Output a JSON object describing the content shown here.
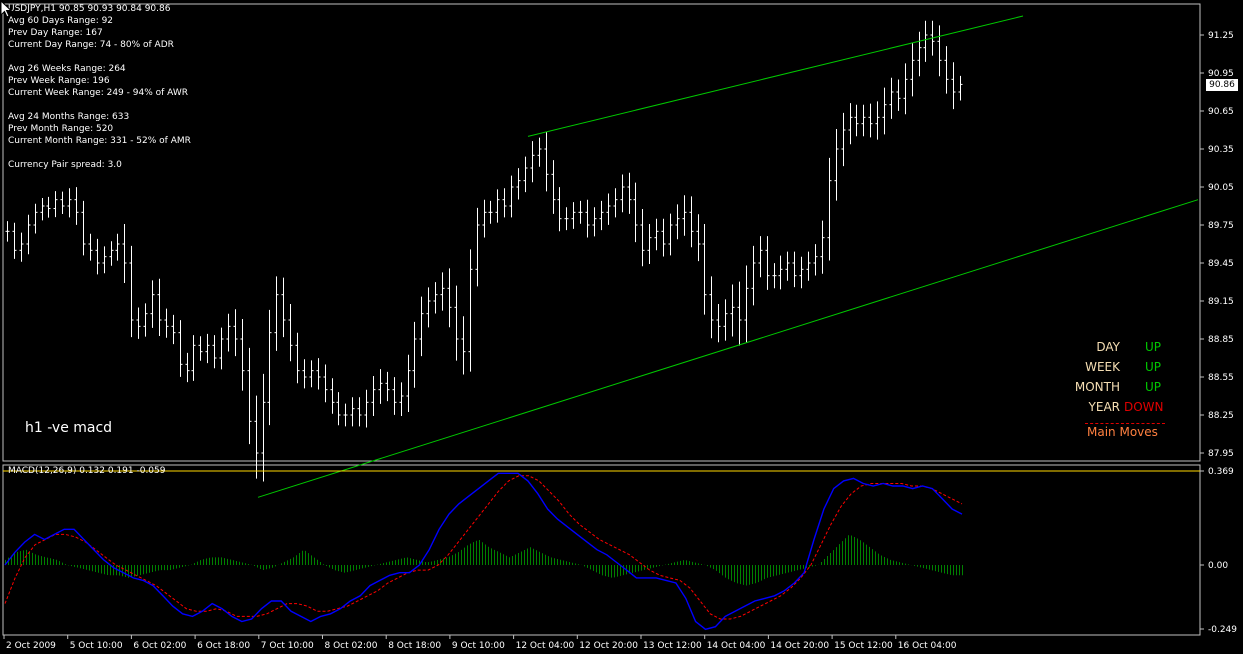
{
  "symbol_header": "USDJPY,H1  90.85 90.93 90.84 90.86",
  "info_lines": [
    "Avg 60 Days Range: 92",
    "Prev Day Range: 167",
    "Current Day Range: 74 - 80% of ADR",
    "",
    "Avg 26 Weeks Range: 264",
    "Prev Week Range: 196",
    "Current Week Range: 249 - 94% of AWR",
    "",
    "Avg 24 Months Range: 633",
    "Prev Month Range: 520",
    "Current Month Range: 331 - 52% of AMR",
    "",
    "Currency Pair spread: 3.0"
  ],
  "chart_note": "h1 -ve macd",
  "current_price": "90.86",
  "trend_panel": {
    "rows": [
      {
        "label": "DAY",
        "value": "UP",
        "state": "up"
      },
      {
        "label": "WEEK",
        "value": "UP",
        "state": "up"
      },
      {
        "label": "MONTH",
        "value": "UP",
        "state": "up"
      },
      {
        "label": "YEAR",
        "value": "DOWN",
        "state": "down"
      }
    ],
    "footer": "Main Moves"
  },
  "macd_title": "MACD(12,26,9) 0.132 0.191 -0.059",
  "colors": {
    "background": "#000000",
    "candles": "#ffffff",
    "channel": "#00c800",
    "macd_line": "#0000ff",
    "signal_line": "#ff0000",
    "histogram": "#008000",
    "level_line": "#ffd700",
    "trend_label": "#f5deb3",
    "trend_up": "#00c800",
    "trend_down": "#e00000",
    "moves": "#ff8040"
  },
  "chart_data": [
    {
      "type": "ohlc",
      "price_axis": {
        "ylim": [
          87.6,
          91.4
        ],
        "ticks": [
          "91.25",
          "90.95",
          "90.65",
          "90.35",
          "90.05",
          "89.75",
          "89.45",
          "89.15",
          "88.85",
          "88.55",
          "88.25",
          "87.95"
        ]
      },
      "time_axis": {
        "ticks": [
          "2 Oct 2009",
          "5 Oct 10:00",
          "6 Oct 02:00",
          "6 Oct 18:00",
          "7 Oct 10:00",
          "8 Oct 02:00",
          "8 Oct 18:00",
          "9 Oct 10:00",
          "12 Oct 04:00",
          "12 Oct 20:00",
          "13 Oct 12:00",
          "14 Oct 04:00",
          "14 Oct 20:00",
          "15 Oct 12:00",
          "16 Oct 04:00"
        ]
      },
      "close_path": [
        89.7,
        89.55,
        89.6,
        89.75,
        89.85,
        89.9,
        89.88,
        89.95,
        89.9,
        89.95,
        89.85,
        89.6,
        89.55,
        89.45,
        89.5,
        89.55,
        89.6,
        89.45,
        89.0,
        88.95,
        89.05,
        89.2,
        89.0,
        88.95,
        88.9,
        88.65,
        88.6,
        88.8,
        88.75,
        88.8,
        88.7,
        88.85,
        88.95,
        88.85,
        88.6,
        88.2,
        87.95,
        88.35,
        88.9,
        89.2,
        89.0,
        88.8,
        88.6,
        88.55,
        88.6,
        88.55,
        88.45,
        88.35,
        88.25,
        88.25,
        88.3,
        88.25,
        88.35,
        88.45,
        88.5,
        88.45,
        88.35,
        88.4,
        88.6,
        88.85,
        89.05,
        89.15,
        89.2,
        89.25,
        89.1,
        88.85,
        88.75,
        89.4,
        89.75,
        89.85,
        89.85,
        89.95,
        89.9,
        90.05,
        90.1,
        90.2,
        90.3,
        90.35,
        90.15,
        89.95,
        89.8,
        89.8,
        89.85,
        89.85,
        89.75,
        89.8,
        89.85,
        89.9,
        89.95,
        90.05,
        89.95,
        89.75,
        89.55,
        89.65,
        89.7,
        89.6,
        89.75,
        89.8,
        89.85,
        89.7,
        89.6,
        89.2,
        89.0,
        88.95,
        89.05,
        89.1,
        89.0,
        89.25,
        89.45,
        89.55,
        89.35,
        89.35,
        89.4,
        89.45,
        89.35,
        89.4,
        89.45,
        89.5,
        89.65,
        90.1,
        90.35,
        90.5,
        90.6,
        90.55,
        90.6,
        90.55,
        90.6,
        90.7,
        90.8,
        90.75,
        90.9,
        91.05,
        91.15,
        91.25,
        91.2,
        91.05,
        90.9,
        90.8,
        90.86
      ],
      "range_path": [
        0.18,
        0.15,
        0.2,
        0.18,
        0.15,
        0.14,
        0.16,
        0.15,
        0.14,
        0.2,
        0.22,
        0.2,
        0.18,
        0.2,
        0.18,
        0.16,
        0.18,
        0.35,
        0.3,
        0.22,
        0.18,
        0.25,
        0.28,
        0.2,
        0.2,
        0.22,
        0.2,
        0.18,
        0.16,
        0.2,
        0.18,
        0.2,
        0.22,
        0.3,
        0.35,
        0.4,
        0.45,
        0.5,
        0.4,
        0.32,
        0.3,
        0.28,
        0.22,
        0.2,
        0.18,
        0.22,
        0.22,
        0.2,
        0.18,
        0.2,
        0.2,
        0.2,
        0.22,
        0.24,
        0.25,
        0.2,
        0.22,
        0.24,
        0.28,
        0.3,
        0.3,
        0.24,
        0.22,
        0.28,
        0.35,
        0.38,
        0.4,
        0.35,
        0.3,
        0.22,
        0.2,
        0.18,
        0.2,
        0.2,
        0.22,
        0.2,
        0.25,
        0.2,
        0.3,
        0.25,
        0.22,
        0.2,
        0.18,
        0.2,
        0.22,
        0.2,
        0.2,
        0.22,
        0.2,
        0.22,
        0.25,
        0.3,
        0.28,
        0.24,
        0.22,
        0.22,
        0.2,
        0.25,
        0.3,
        0.28,
        0.3,
        0.35,
        0.32,
        0.28,
        0.25,
        0.4,
        0.45,
        0.4,
        0.3,
        0.25,
        0.25,
        0.22,
        0.24,
        0.2,
        0.2,
        0.22,
        0.2,
        0.22,
        0.3,
        0.4,
        0.35,
        0.3,
        0.25,
        0.22,
        0.22,
        0.24,
        0.28,
        0.3,
        0.25,
        0.22,
        0.28,
        0.3,
        0.28,
        0.25,
        0.25,
        0.28,
        0.25,
        0.3,
        0.15
      ],
      "channel": {
        "upper": {
          "from": [
            528,
            90.45
          ],
          "to": [
            1023,
            91.4
          ]
        },
        "lower": {
          "from": [
            258,
            87.6
          ],
          "to": [
            1198,
            89.95
          ]
        }
      }
    },
    {
      "type": "macd",
      "params": "12,26,9",
      "ylim": [
        -0.249,
        0.369
      ],
      "ticks": [
        "0.369",
        "0.00",
        "-0.249"
      ],
      "level": 0.369,
      "macd": [
        0.0,
        0.05,
        0.09,
        0.12,
        0.1,
        0.12,
        0.14,
        0.14,
        0.1,
        0.06,
        0.02,
        -0.01,
        -0.03,
        -0.05,
        -0.06,
        -0.08,
        -0.12,
        -0.16,
        -0.19,
        -0.2,
        -0.18,
        -0.15,
        -0.17,
        -0.2,
        -0.22,
        -0.21,
        -0.17,
        -0.14,
        -0.14,
        -0.18,
        -0.2,
        -0.22,
        -0.2,
        -0.19,
        -0.17,
        -0.14,
        -0.12,
        -0.08,
        -0.06,
        -0.04,
        -0.03,
        -0.03,
        0.0,
        0.06,
        0.14,
        0.2,
        0.24,
        0.27,
        0.3,
        0.33,
        0.36,
        0.36,
        0.36,
        0.33,
        0.28,
        0.22,
        0.18,
        0.15,
        0.12,
        0.09,
        0.06,
        0.04,
        0.01,
        -0.02,
        -0.05,
        -0.05,
        -0.05,
        -0.06,
        -0.07,
        -0.13,
        -0.22,
        -0.25,
        -0.24,
        -0.2,
        -0.18,
        -0.16,
        -0.14,
        -0.13,
        -0.12,
        -0.1,
        -0.07,
        -0.03,
        0.1,
        0.22,
        0.3,
        0.33,
        0.34,
        0.32,
        0.31,
        0.32,
        0.31,
        0.31,
        0.3,
        0.31,
        0.3,
        0.26,
        0.22,
        0.2
      ],
      "signal": [
        -0.15,
        -0.05,
        0.03,
        0.08,
        0.1,
        0.12,
        0.12,
        0.11,
        0.09,
        0.06,
        0.03,
        0.0,
        -0.02,
        -0.04,
        -0.06,
        -0.08,
        -0.11,
        -0.14,
        -0.17,
        -0.18,
        -0.18,
        -0.17,
        -0.18,
        -0.2,
        -0.2,
        -0.2,
        -0.19,
        -0.17,
        -0.15,
        -0.15,
        -0.16,
        -0.18,
        -0.18,
        -0.17,
        -0.16,
        -0.14,
        -0.12,
        -0.1,
        -0.07,
        -0.05,
        -0.03,
        -0.02,
        -0.02,
        0.0,
        0.04,
        0.09,
        0.14,
        0.19,
        0.24,
        0.29,
        0.33,
        0.35,
        0.35,
        0.33,
        0.29,
        0.25,
        0.2,
        0.16,
        0.13,
        0.1,
        0.08,
        0.06,
        0.04,
        0.01,
        -0.02,
        -0.04,
        -0.05,
        -0.06,
        -0.09,
        -0.14,
        -0.19,
        -0.21,
        -0.21,
        -0.2,
        -0.18,
        -0.16,
        -0.14,
        -0.12,
        -0.09,
        -0.05,
        0.0,
        0.08,
        0.16,
        0.23,
        0.28,
        0.31,
        0.32,
        0.32,
        0.32,
        0.32,
        0.31,
        0.31,
        0.3,
        0.28,
        0.26,
        0.24
      ],
      "histogram_samples": [
        0.02,
        0.05,
        0.06,
        0.04,
        0.03,
        0.02,
        0.0,
        -0.01,
        -0.02,
        -0.03,
        -0.04,
        -0.04,
        -0.05,
        -0.04,
        -0.03,
        -0.02,
        -0.02,
        -0.01,
        0.0,
        0.02,
        0.03,
        0.03,
        0.02,
        0.01,
        0.0,
        -0.02,
        -0.01,
        0.01,
        0.03,
        0.06,
        0.03,
        0.0,
        -0.02,
        -0.03,
        -0.02,
        -0.01,
        0.0,
        0.01,
        0.02,
        0.03,
        0.02,
        0.01,
        0.02,
        0.03,
        0.05,
        0.08,
        0.1,
        0.07,
        0.05,
        0.03,
        0.05,
        0.07,
        0.05,
        0.03,
        0.02,
        0.01,
        0.0,
        -0.02,
        -0.04,
        -0.05,
        -0.04,
        -0.03,
        -0.02,
        -0.01,
        0.0,
        0.01,
        0.02,
        0.01,
        0.0,
        -0.02,
        -0.05,
        -0.07,
        -0.08,
        -0.07,
        -0.05,
        -0.04,
        -0.03,
        -0.02,
        -0.01,
        0.0,
        0.04,
        0.08,
        0.12,
        0.1,
        0.07,
        0.04,
        0.02,
        0.01,
        0.0,
        -0.01,
        -0.02,
        -0.03,
        -0.04,
        -0.04
      ]
    }
  ]
}
